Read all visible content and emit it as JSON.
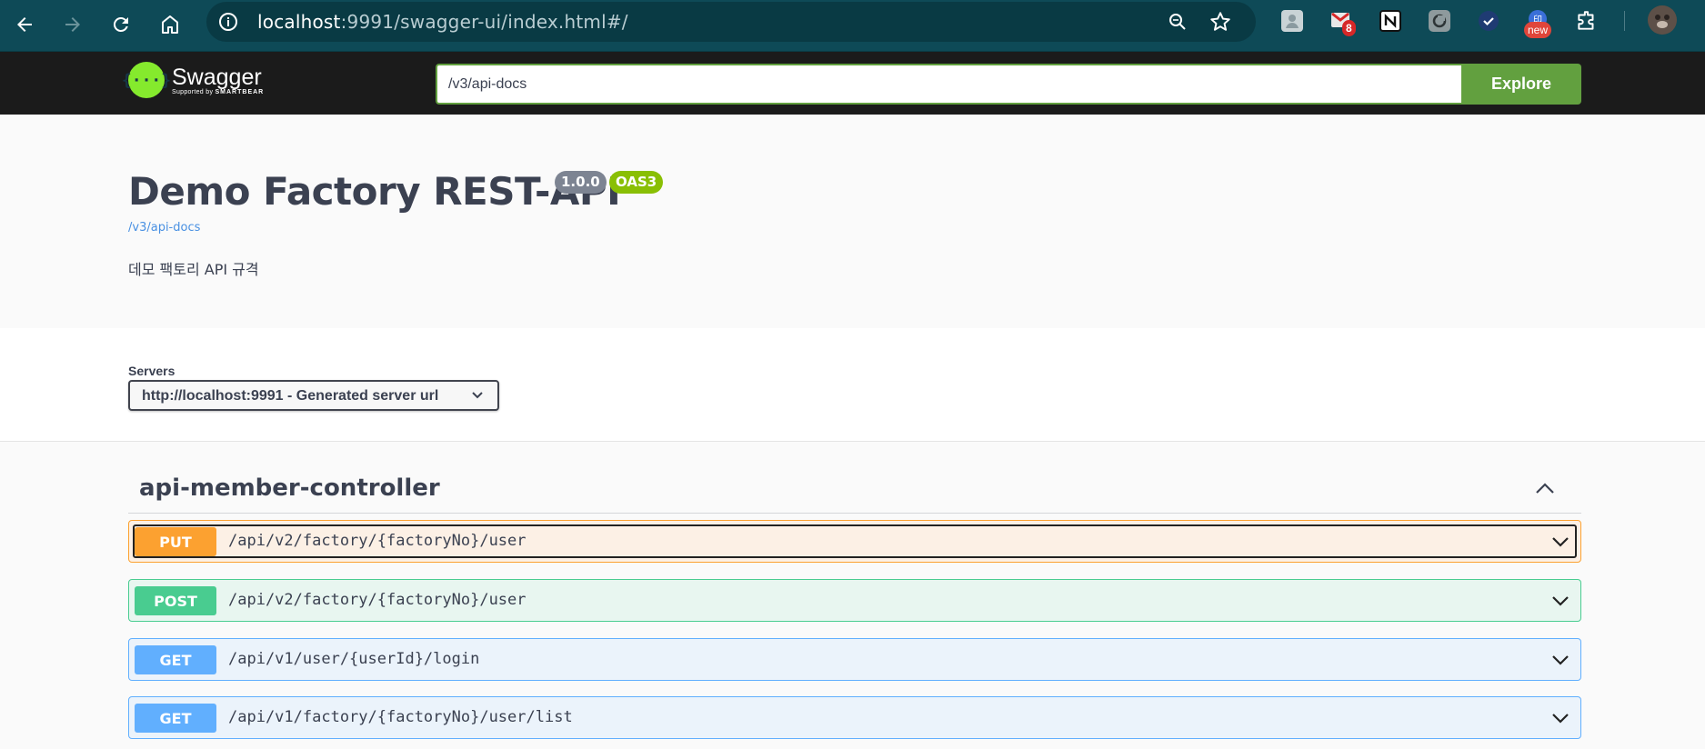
{
  "browser": {
    "url_host": "localhost",
    "url_rest": ":9991/swagger-ui/index.html#/",
    "extension_badge_count": "8",
    "extension_new_label": "new"
  },
  "topbar": {
    "logo_title": "Swagger",
    "logo_supported": "Supported by",
    "logo_company": "SMARTBEAR",
    "explore_value": "/v3/api-docs",
    "explore_button": "Explore"
  },
  "info": {
    "title": "Demo Factory REST-API",
    "version": "1.0.0",
    "oas_badge": "OAS3",
    "spec_link": "/v3/api-docs",
    "description": "데모 팩토리 API 규격"
  },
  "servers": {
    "label": "Servers",
    "selected": "http://localhost:9991 - Generated server url"
  },
  "tag": {
    "name": "api-member-controller"
  },
  "operations": [
    {
      "method": "PUT",
      "path": "/api/v2/factory/{factoryNo}/user"
    },
    {
      "method": "POST",
      "path": "/api/v2/factory/{factoryNo}/user"
    },
    {
      "method": "GET",
      "path": "/api/v1/user/{userId}/login"
    },
    {
      "method": "GET",
      "path": "/api/v1/factory/{factoryNo}/user/list"
    }
  ],
  "colors": {
    "put": "#fca130",
    "post": "#49cc90",
    "get": "#61affe",
    "swagger_green": "#62a03f",
    "brand_lime": "#85ea2d"
  }
}
